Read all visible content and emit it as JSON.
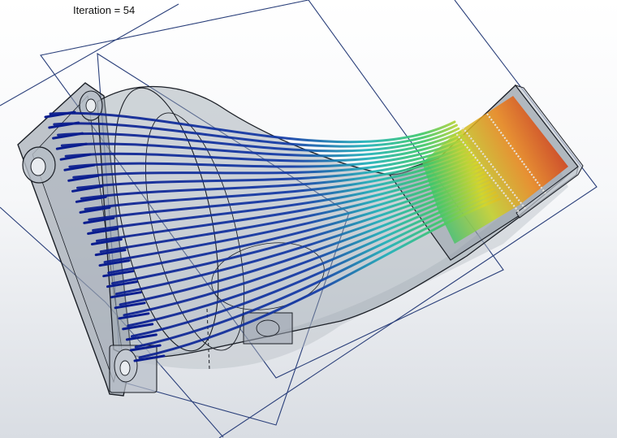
{
  "viewport": {
    "iteration_label": "Iteration = 54",
    "background_top": "#ffffff",
    "background_bottom": "#d9dde3"
  },
  "model": {
    "name": "manifold-body",
    "body_fill": "#9aa3ae",
    "edge_color": "#1b1f26",
    "section_plane_color": "#2a3f7a"
  },
  "flow_trajectories": {
    "count": 24,
    "color_scale": [
      "#0a1d8f",
      "#1f55c8",
      "#1fb0b8",
      "#3cc86a",
      "#d4d62a",
      "#f08a1a",
      "#d42814"
    ]
  }
}
